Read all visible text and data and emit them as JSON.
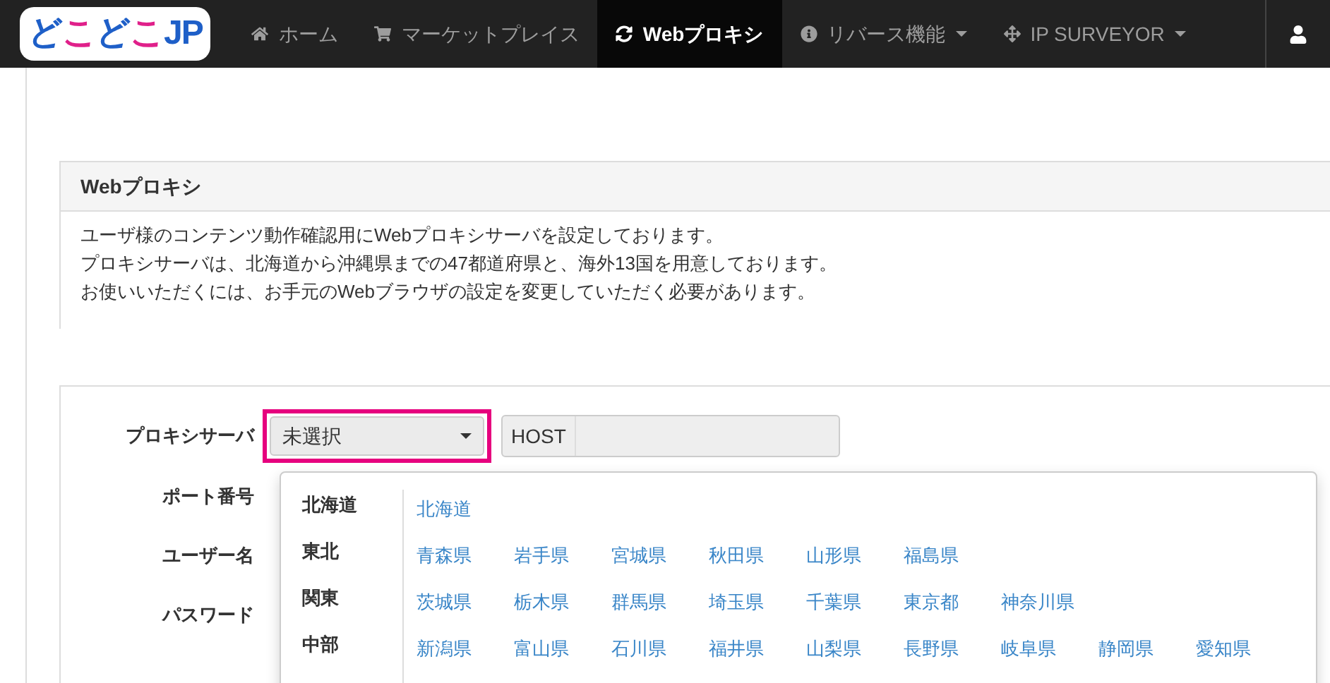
{
  "navbar": {
    "logo": "どこどこJP",
    "items": [
      {
        "label": "ホーム",
        "selected": false,
        "has_menu": false
      },
      {
        "label": "マーケットプレイス",
        "selected": false,
        "has_menu": false
      },
      {
        "label": "Webプロキシ",
        "selected": true,
        "has_menu": false
      },
      {
        "label": "リバース機能",
        "selected": false,
        "has_menu": true
      },
      {
        "label": "IP SURVEYOR",
        "selected": false,
        "has_menu": true
      }
    ]
  },
  "panel": {
    "title": "Webプロキシ",
    "description": [
      "ユーザ様のコンテンツ動作確認用にWebプロキシサーバを設定しております。",
      "プロキシサーバは、北海道から沖縄県までの47都道府県と、海外13国を用意しております。",
      "お使いいただくには、お手元のWebブラウザの設定を変更していただく必要があります。"
    ]
  },
  "form": {
    "labels": [
      "プロキシサーバ",
      "ポート番号",
      "ユーザー名",
      "パスワード"
    ],
    "select": {
      "value": "未選択",
      "highlighted": true
    },
    "host": {
      "addon": "HOST"
    },
    "dropdown": {
      "regions": [
        {
          "label": "北海道",
          "selected": false
        },
        {
          "label": "東北",
          "selected": false
        },
        {
          "label": "関東",
          "selected": false
        },
        {
          "label": "中部",
          "selected": false
        }
      ],
      "rows": [
        [
          "北海道"
        ],
        [
          "青森県",
          "岩手県",
          "宮城県",
          "秋田県",
          "山形県",
          "福島県"
        ],
        [
          "茨城県",
          "栃木県",
          "群馬県",
          "埼玉県",
          "千葉県",
          "東京都",
          "神奈川県"
        ],
        [
          "新潟県",
          "富山県",
          "石川県",
          "福井県",
          "山梨県",
          "長野県",
          "岐阜県",
          "静岡県",
          "愛知県"
        ]
      ]
    }
  }
}
